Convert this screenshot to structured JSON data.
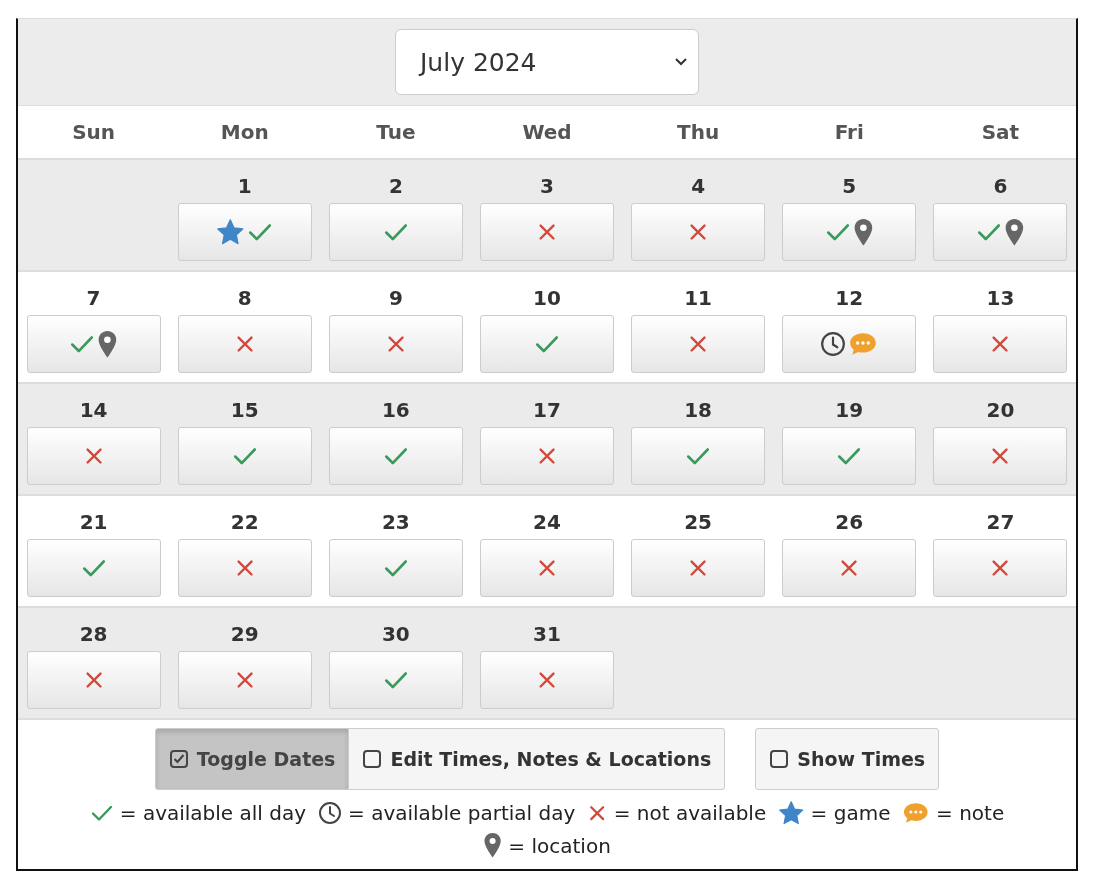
{
  "month_select": {
    "value": "July 2024"
  },
  "weekdays": [
    "Sun",
    "Mon",
    "Tue",
    "Wed",
    "Thu",
    "Fri",
    "Sat"
  ],
  "weeks": [
    {
      "days": [
        {
          "kind": "blank"
        },
        {
          "kind": "day",
          "number": "1",
          "marks": [
            {
              "kind": "game"
            },
            {
              "kind": "available"
            }
          ]
        },
        {
          "kind": "day",
          "number": "2",
          "marks": [
            {
              "kind": "available"
            }
          ]
        },
        {
          "kind": "day",
          "number": "3",
          "marks": [
            {
              "kind": "unavailable"
            }
          ]
        },
        {
          "kind": "day",
          "number": "4",
          "marks": [
            {
              "kind": "unavailable"
            }
          ]
        },
        {
          "kind": "day",
          "number": "5",
          "marks": [
            {
              "kind": "available"
            },
            {
              "kind": "location"
            }
          ]
        },
        {
          "kind": "day",
          "number": "6",
          "marks": [
            {
              "kind": "available"
            },
            {
              "kind": "location"
            }
          ]
        }
      ]
    },
    {
      "days": [
        {
          "kind": "day",
          "number": "7",
          "marks": [
            {
              "kind": "available"
            },
            {
              "kind": "location"
            }
          ]
        },
        {
          "kind": "day",
          "number": "8",
          "marks": [
            {
              "kind": "unavailable"
            }
          ]
        },
        {
          "kind": "day",
          "number": "9",
          "marks": [
            {
              "kind": "unavailable"
            }
          ]
        },
        {
          "kind": "day",
          "number": "10",
          "marks": [
            {
              "kind": "available"
            }
          ]
        },
        {
          "kind": "day",
          "number": "11",
          "marks": [
            {
              "kind": "unavailable"
            }
          ]
        },
        {
          "kind": "day",
          "number": "12",
          "marks": [
            {
              "kind": "partial"
            },
            {
              "kind": "note"
            }
          ]
        },
        {
          "kind": "day",
          "number": "13",
          "marks": [
            {
              "kind": "unavailable"
            }
          ]
        }
      ]
    },
    {
      "days": [
        {
          "kind": "day",
          "number": "14",
          "marks": [
            {
              "kind": "unavailable"
            }
          ]
        },
        {
          "kind": "day",
          "number": "15",
          "marks": [
            {
              "kind": "available"
            }
          ]
        },
        {
          "kind": "day",
          "number": "16",
          "marks": [
            {
              "kind": "available"
            }
          ]
        },
        {
          "kind": "day",
          "number": "17",
          "marks": [
            {
              "kind": "unavailable"
            }
          ]
        },
        {
          "kind": "day",
          "number": "18",
          "marks": [
            {
              "kind": "available"
            }
          ]
        },
        {
          "kind": "day",
          "number": "19",
          "marks": [
            {
              "kind": "available"
            }
          ]
        },
        {
          "kind": "day",
          "number": "20",
          "marks": [
            {
              "kind": "unavailable"
            }
          ]
        }
      ]
    },
    {
      "days": [
        {
          "kind": "day",
          "number": "21",
          "marks": [
            {
              "kind": "available"
            }
          ]
        },
        {
          "kind": "day",
          "number": "22",
          "marks": [
            {
              "kind": "unavailable"
            }
          ]
        },
        {
          "kind": "day",
          "number": "23",
          "marks": [
            {
              "kind": "available"
            }
          ]
        },
        {
          "kind": "day",
          "number": "24",
          "marks": [
            {
              "kind": "unavailable"
            }
          ]
        },
        {
          "kind": "day",
          "number": "25",
          "marks": [
            {
              "kind": "unavailable"
            }
          ]
        },
        {
          "kind": "day",
          "number": "26",
          "marks": [
            {
              "kind": "unavailable"
            }
          ]
        },
        {
          "kind": "day",
          "number": "27",
          "marks": [
            {
              "kind": "unavailable"
            }
          ]
        }
      ]
    },
    {
      "days": [
        {
          "kind": "day",
          "number": "28",
          "marks": [
            {
              "kind": "unavailable"
            }
          ]
        },
        {
          "kind": "day",
          "number": "29",
          "marks": [
            {
              "kind": "unavailable"
            }
          ]
        },
        {
          "kind": "day",
          "number": "30",
          "marks": [
            {
              "kind": "available"
            }
          ]
        },
        {
          "kind": "day",
          "number": "31",
          "marks": [
            {
              "kind": "unavailable"
            }
          ]
        },
        {
          "kind": "blank"
        },
        {
          "kind": "blank"
        },
        {
          "kind": "blank"
        }
      ]
    }
  ],
  "mode_buttons": [
    {
      "label": "Toggle Dates",
      "checked": true,
      "selected": true
    },
    {
      "label": "Edit Times, Notes & Locations",
      "checked": false,
      "selected": false
    }
  ],
  "show_times": {
    "label": "Show Times",
    "checked": false
  },
  "legend": [
    {
      "kind": "available",
      "text": "= available all day"
    },
    {
      "kind": "partial",
      "text": "= available partial day"
    },
    {
      "kind": "unavailable",
      "text": "= not available"
    },
    {
      "kind": "game",
      "text": "= game"
    },
    {
      "kind": "note",
      "text": "= note"
    },
    {
      "kind": "location",
      "text": "= location"
    }
  ]
}
